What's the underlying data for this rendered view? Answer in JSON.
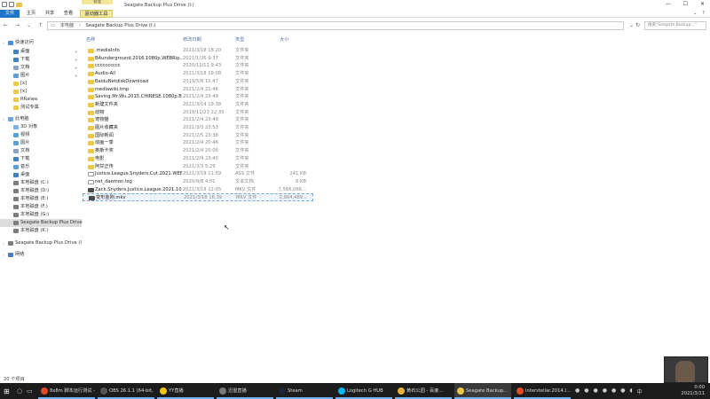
{
  "window": {
    "title": "Seagate Backup Plus Drive (I:)",
    "context_tab": "管理",
    "controls": [
      "—",
      "☐",
      "✕"
    ]
  },
  "ribbon": {
    "tabs": [
      "文件",
      "主页",
      "共享",
      "查看",
      "驱动器工具"
    ],
    "help": "?"
  },
  "address": {
    "path": [
      "本电脑",
      "Seagate Backup Plus Drive (I:)"
    ],
    "search_placeholder": "搜索\"Seagate Backup...\""
  },
  "sidebar": {
    "items": [
      {
        "label": "快速访问",
        "icon": "star-icon",
        "level": 0
      },
      {
        "label": "桌面",
        "icon": "desktop-icon",
        "level": 1,
        "pinned": true
      },
      {
        "label": "下载",
        "icon": "download-icon",
        "level": 1,
        "pinned": true
      },
      {
        "label": "文档",
        "icon": "document-icon",
        "level": 1,
        "pinned": true
      },
      {
        "label": "图片",
        "icon": "picture-icon",
        "level": 1,
        "pinned": true
      },
      {
        "label": "[x]",
        "icon": "folder-icon",
        "level": 1
      },
      {
        "label": "[x]",
        "icon": "folder-icon",
        "level": 1
      },
      {
        "label": "RRalwa",
        "icon": "folder-icon",
        "level": 1
      },
      {
        "label": "测试专属",
        "icon": "folder-icon",
        "level": 1
      },
      {
        "label": "此电脑",
        "icon": "computer-icon",
        "level": 0
      },
      {
        "label": "3D 对象",
        "icon": "cube-icon",
        "level": 1
      },
      {
        "label": "视频",
        "icon": "video-icon",
        "level": 1
      },
      {
        "label": "图片",
        "icon": "picture-icon",
        "level": 1
      },
      {
        "label": "文档",
        "icon": "document-icon",
        "level": 1
      },
      {
        "label": "下载",
        "icon": "download-icon",
        "level": 1
      },
      {
        "label": "音乐",
        "icon": "music-icon",
        "level": 1
      },
      {
        "label": "桌面",
        "icon": "desktop-icon",
        "level": 1
      },
      {
        "label": "本地磁盘 (C:)",
        "icon": "drive-icon",
        "level": 1
      },
      {
        "label": "本地磁盘 (D:)",
        "icon": "drive-icon",
        "level": 1
      },
      {
        "label": "本地磁盘 (E:)",
        "icon": "drive-icon",
        "level": 1
      },
      {
        "label": "本地磁盘 (F:)",
        "icon": "drive-icon",
        "level": 1
      },
      {
        "label": "本地磁盘 (G:)",
        "icon": "drive-icon",
        "level": 1
      },
      {
        "label": "Seagate Backup Plus Drive",
        "icon": "drive-icon",
        "level": 1,
        "selected": true
      },
      {
        "label": "本地磁盘 (K:)",
        "icon": "drive-icon",
        "level": 1
      },
      {
        "label": "Seagate Backup Plus Drive (I",
        "icon": "drive-icon",
        "level": 0
      },
      {
        "label": "网络",
        "icon": "network-icon",
        "level": 0
      }
    ]
  },
  "columns": {
    "name": "名称",
    "date": "修改日期",
    "type": "类型",
    "size": "大小"
  },
  "files": [
    {
      "name": ".mediaInfo",
      "date": "2021/3/18 18:20",
      "type": "文件夹",
      "size": "",
      "kind": "folder"
    },
    {
      "name": "BAunderground.2016.1080p.WEBRip...",
      "date": "2021/1/26 9:37",
      "type": "文件夹",
      "size": "",
      "kind": "folder"
    },
    {
      "name": "cccccccccc",
      "date": "2020/11/11 9:43",
      "type": "文件夹",
      "size": "",
      "kind": "folder"
    },
    {
      "name": "Audio-All",
      "date": "2021/3/18 19:08",
      "type": "文件夹",
      "size": "",
      "kind": "folder"
    },
    {
      "name": "BaiduNetdiskDownload",
      "date": "2019/5/8 12:47",
      "type": "文件夹",
      "size": "",
      "kind": "folder"
    },
    {
      "name": "mediawiki.tmp",
      "date": "2021/2/4 21:46",
      "type": "文件夹",
      "size": "",
      "kind": "folder"
    },
    {
      "name": "Saving.Mr.Wu.2015.CHINESE.1080p.B...",
      "date": "2021/2/4 23:49",
      "type": "文件夹",
      "size": "",
      "kind": "folder"
    },
    {
      "name": "新建文件夹",
      "date": "2021/3/14 19:38",
      "type": "文件夹",
      "size": "",
      "kind": "folder"
    },
    {
      "name": "动物",
      "date": "2019/11/23 22:35",
      "type": "文件夹",
      "size": "",
      "kind": "folder"
    },
    {
      "name": "宠物猫",
      "date": "2021/2/4 23:49",
      "type": "文件夹",
      "size": "",
      "kind": "folder"
    },
    {
      "name": "图片收藏夹",
      "date": "2021/3/3 23:53",
      "type": "文件夹",
      "size": "",
      "kind": "folder"
    },
    {
      "name": "国际新闻",
      "date": "2021/2/5 23:38",
      "type": "文件夹",
      "size": "",
      "kind": "folder"
    },
    {
      "name": "动画一季",
      "date": "2021/2/4 20:46",
      "type": "文件夹",
      "size": "",
      "kind": "folder"
    },
    {
      "name": "奥斯卡奖",
      "date": "2021/2/4 20:06",
      "type": "文件夹",
      "size": "",
      "kind": "folder"
    },
    {
      "name": "电影",
      "date": "2021/2/4 23:40",
      "type": "文件夹",
      "size": "",
      "kind": "folder"
    },
    {
      "name": "阿甘正传",
      "date": "2021/3/3 5:29",
      "type": "文件夹",
      "size": "",
      "kind": "folder"
    },
    {
      "name": "Justice.League.Snyders.Cut.2021.WEB...",
      "date": "2021/3/18 11:59",
      "type": "ASS 文件",
      "size": "241 KB",
      "kind": "file"
    },
    {
      "name": "net_daemon.log",
      "date": "2020/9/8 4:51",
      "type": "文本文档",
      "size": "6 KB",
      "kind": "file"
    },
    {
      "name": "Zack.Snyders.Justice.League.2021.108...",
      "date": "2021/3/18 12:05",
      "type": "MKV 文件",
      "size": "7,566,066...",
      "kind": "video"
    },
    {
      "name": "变形金刚.mkv",
      "date": "2021/3/18 16:39",
      "type": "MKV 文件",
      "size": "2,904,489...",
      "kind": "video",
      "selected": true
    }
  ],
  "status": {
    "count": "20 个项目"
  },
  "taskbar": {
    "search_icon": "search-icon",
    "apps": [
      {
        "label": "8x8m 脚本运行测试 - ...",
        "color": "#e34c26"
      },
      {
        "label": "OBS 26.1.1 (64-bit, ...",
        "color": "#555555"
      },
      {
        "label": "YY直播",
        "color": "#f5c400"
      },
      {
        "label": "迅雷直播",
        "color": "#7a7a7a"
      },
      {
        "label": "Steam",
        "color": "#1b2838"
      },
      {
        "label": "Logitech G HUB",
        "color": "#00b8fc"
      },
      {
        "label": "黄石公园 - 百度...",
        "color": "#e8b23a"
      },
      {
        "label": "Seagate Backup...",
        "color": "#f0c648",
        "active": true
      },
      {
        "label": "Interstellar.2014.I...",
        "color": "#e34c26"
      }
    ],
    "clock_time": "0:00",
    "clock_date": "2021/3/11"
  }
}
